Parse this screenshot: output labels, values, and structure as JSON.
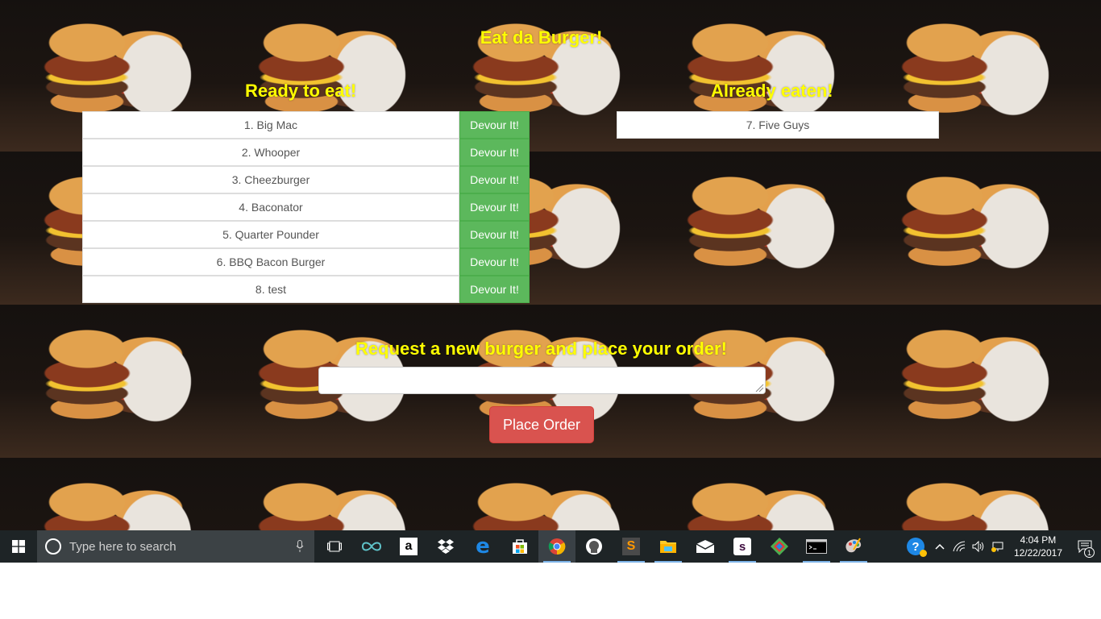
{
  "page": {
    "title": "Eat da Burger!",
    "ready_heading": "Ready to eat!",
    "eaten_heading": "Already eaten!",
    "request_heading": "Request a new burger and place your order!",
    "place_order_label": "Place Order",
    "input_value": ""
  },
  "ready_burgers": [
    {
      "label": "1. Big Mac",
      "button": "Devour It!"
    },
    {
      "label": "2. Whooper",
      "button": "Devour It!"
    },
    {
      "label": "3. Cheezburger",
      "button": "Devour It!"
    },
    {
      "label": "4. Baconator",
      "button": "Devour It!"
    },
    {
      "label": "5. Quarter Pounder",
      "button": "Devour It!"
    },
    {
      "label": "6. BBQ Bacon Burger",
      "button": "Devour It!"
    },
    {
      "label": "8. test",
      "button": "Devour It!"
    }
  ],
  "eaten_burgers": [
    {
      "label": "7. Five Guys"
    }
  ],
  "taskbar": {
    "search_placeholder": "Type here to search",
    "time": "4:04 PM",
    "date": "12/22/2017",
    "notification_count": "1",
    "apps": [
      "task-view",
      "infinity",
      "amazon",
      "dropbox",
      "edge",
      "store",
      "chrome",
      "gitkraken",
      "sublime",
      "file-explorer",
      "mail",
      "slack",
      "sourcetree",
      "terminal",
      "paint"
    ]
  },
  "colors": {
    "heading": "#ffff00",
    "devour_button": "#5cb85c",
    "place_order_button": "#d9534f",
    "taskbar": "#1e2426"
  }
}
